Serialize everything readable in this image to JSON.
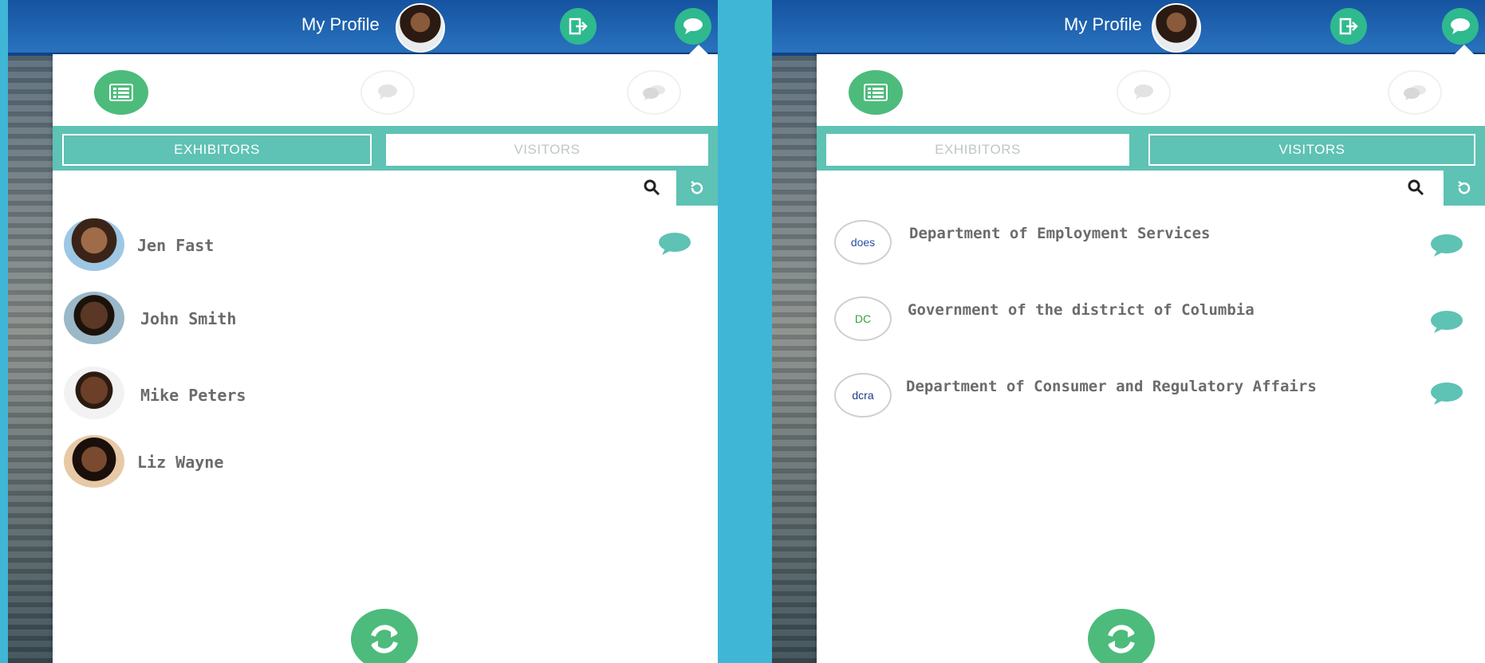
{
  "header": {
    "profile_label": "My Profile",
    "logout_icon": "logout-icon",
    "chat_icon": "chat-icon"
  },
  "colors": {
    "accent": "#5ec2b4",
    "green": "#4dbb7c",
    "text": "#6b6b6b"
  },
  "left_panel": {
    "tabs": {
      "exhibitors": "EXHIBITORS",
      "visitors": "VISITORS",
      "active": "exhibitors"
    },
    "search": {
      "value": "",
      "placeholder": ""
    },
    "people": [
      {
        "name": "Jen Fast"
      },
      {
        "name": "John Smith"
      },
      {
        "name": "Mike Peters"
      },
      {
        "name": "Liz Wayne"
      }
    ]
  },
  "right_panel": {
    "tabs": {
      "exhibitors": "EXHIBITORS",
      "visitors": "VISITORS",
      "active": "visitors"
    },
    "search": {
      "value": "",
      "placeholder": ""
    },
    "organizations": [
      {
        "name": "Department of Employment Services",
        "logo_text": "does"
      },
      {
        "name": "Government of the district of Columbia",
        "logo_text": "DC"
      },
      {
        "name": "Department of Consumer and Regulatory Affairs",
        "logo_text": "dcra"
      }
    ]
  }
}
